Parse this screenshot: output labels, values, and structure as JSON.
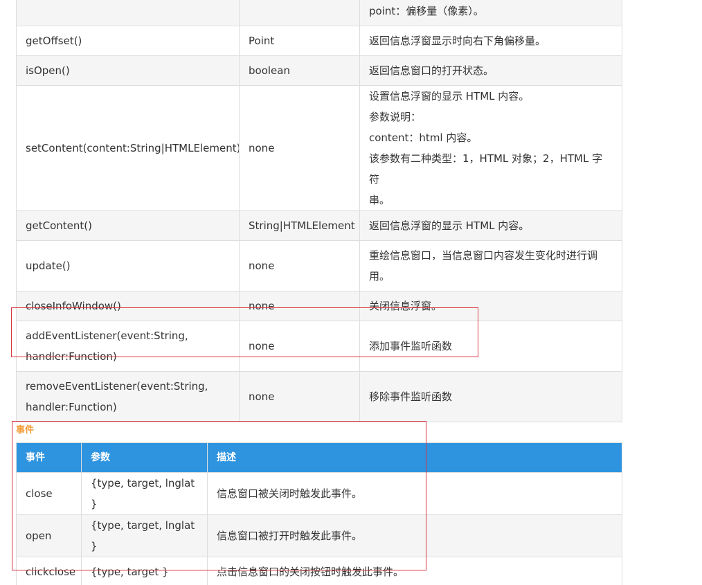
{
  "methods": {
    "rows": [
      {
        "name": "",
        "returns": "",
        "desc": [
          "point：偏移量（像素）。"
        ]
      },
      {
        "name": "getOffset()",
        "returns": "Point",
        "desc": [
          "返回信息浮窗显示时向右下角偏移量。"
        ]
      },
      {
        "name": "isOpen()",
        "returns": "boolean",
        "desc": [
          "返回信息窗口的打开状态。"
        ]
      },
      {
        "name": "setContent(content:String|HTMLElement)",
        "returns": "none",
        "desc": [
          "设置信息浮窗的显示 HTML 内容。",
          "参数说明：",
          "content：html 内容。",
          "该参数有二种类型：1，HTML 对象；2，HTML 字符",
          "串。"
        ]
      },
      {
        "name": "getContent()",
        "returns": "String|HTMLElement",
        "desc": [
          "返回信息浮窗的显示 HTML 内容。"
        ]
      },
      {
        "name": "update()",
        "returns": "none",
        "desc": [
          "重绘信息窗口，当信息窗口内容发生变化时进行调",
          "用。"
        ]
      },
      {
        "name": "closeInfoWindow()",
        "returns": "none",
        "desc": [
          "关闭信息浮窗。"
        ]
      },
      {
        "name": [
          "addEventListener(event:String,",
          "handler:Function)"
        ],
        "returns": "none",
        "desc": [
          "添加事件监听函数"
        ]
      },
      {
        "name": [
          "removeEventListener(event:String,",
          "handler:Function)"
        ],
        "returns": "none",
        "desc": [
          "移除事件监听函数"
        ]
      }
    ]
  },
  "events": {
    "title": "事件",
    "headers": [
      "事件",
      "参数",
      "描述"
    ],
    "rows": [
      {
        "event": "close",
        "params": "{type, target, lnglat }",
        "desc": "信息窗口被关闭时触发此事件。"
      },
      {
        "event": "open",
        "params": "{type, target, lnglat }",
        "desc": "信息窗口被打开时触发此事件。"
      },
      {
        "event": "clickclose",
        "params": "{type, target }",
        "desc": "点击信息窗口的关闭按钮时触发此事件。"
      }
    ]
  },
  "colors": {
    "header_bg": "#2e94e0",
    "title": "#f39c39",
    "highlight": "#d9363e"
  }
}
